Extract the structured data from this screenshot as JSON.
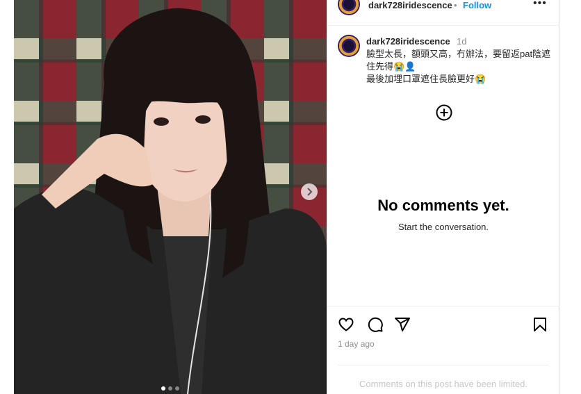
{
  "post": {
    "username": "dark728iridescence",
    "follow_separator": "•",
    "follow_label": "Follow",
    "more_label": "•••"
  },
  "caption": {
    "username": "dark728iridescence",
    "time": "1d",
    "text": "臉型太長，額頭又高，冇辦法，要留返pat陰遮住先得😭👤\n最後加埋口罩遮住長臉更好😭"
  },
  "comments": {
    "empty_title": "No comments yet.",
    "empty_subtitle": "Start the conversation."
  },
  "footer": {
    "time_ago": "1 day ago",
    "limited_notice": "Comments on this post have been limited."
  },
  "carousel": {
    "total_slides": 3,
    "current_slide": 1
  },
  "icons": {
    "like": "heart-icon",
    "comment": "comment-bubble-icon",
    "share": "paper-plane-icon",
    "save": "bookmark-icon",
    "add_comment": "plus-circle-icon",
    "next": "chevron-right-icon"
  },
  "colors": {
    "link": "#0095f6",
    "muted": "#8e8e8e",
    "border": "#dbdbdb"
  }
}
